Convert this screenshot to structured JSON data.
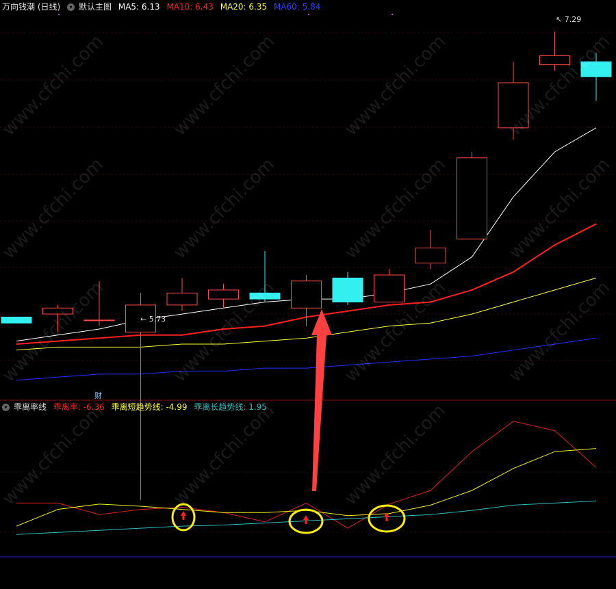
{
  "top_header": {
    "stock_name": "万向钱潮 (日线)",
    "main_chart_label": "默认主图",
    "ma5": "MA5: 6.13",
    "ma10": "MA10: 6.43",
    "ma20": "MA20: 6.35",
    "ma60": "MA60: 5.84",
    "colors": {
      "ma5": "#ffffff",
      "ma10": "#ff2020",
      "ma20": "#ffff33",
      "ma60": "#2030ff"
    }
  },
  "price_annotations": {
    "high": "7.29",
    "low": "5.73",
    "finance_mark": "财"
  },
  "bottom_header": {
    "indicator": "乖离率线",
    "bias": "乖离率: -6.36",
    "short_trend": "乖离短趋势线: -4.99",
    "long_trend": "乖离长趋势线: 1.95"
  },
  "watermark": "www.cfchi.com",
  "chart_data": [
    {
      "type": "candlestick",
      "title": "万向钱潮 (日线)",
      "candles": [
        {
          "open": 6.34,
          "close": 6.32,
          "high": 6.34,
          "low": 6.32
        },
        {
          "open": 6.35,
          "close": 6.37,
          "high": 6.38,
          "low": 6.29
        },
        {
          "open": 6.33,
          "close": 6.33,
          "high": 6.46,
          "low": 6.31
        },
        {
          "open": 6.29,
          "close": 6.38,
          "high": 6.42,
          "low": 5.73
        },
        {
          "open": 6.38,
          "close": 6.42,
          "high": 6.47,
          "low": 6.36
        },
        {
          "open": 6.4,
          "close": 6.43,
          "high": 6.45,
          "low": 6.37
        },
        {
          "open": 6.42,
          "close": 6.4,
          "high": 6.56,
          "low": 6.39
        },
        {
          "open": 6.37,
          "close": 6.46,
          "high": 6.48,
          "low": 6.31
        },
        {
          "open": 6.47,
          "close": 6.39,
          "high": 6.49,
          "low": 6.38
        },
        {
          "open": 6.39,
          "close": 6.48,
          "high": 6.5,
          "low": 6.39
        },
        {
          "open": 6.52,
          "close": 6.57,
          "high": 6.63,
          "low": 6.5
        },
        {
          "open": 6.6,
          "close": 6.87,
          "high": 6.89,
          "low": 6.6
        },
        {
          "open": 6.97,
          "close": 7.12,
          "high": 7.19,
          "low": 6.93
        },
        {
          "open": 7.18,
          "close": 7.21,
          "high": 7.29,
          "low": 7.16
        },
        {
          "open": 7.19,
          "close": 7.14,
          "high": 7.22,
          "low": 7.06
        }
      ],
      "series": [
        {
          "name": "MA5",
          "color": "#ffffff",
          "width": 1,
          "values": [
            6.26,
            6.28,
            6.3,
            6.33,
            6.35,
            6.37,
            6.39,
            6.4,
            6.4,
            6.42,
            6.45,
            6.54,
            6.74,
            6.89,
            6.97
          ]
        },
        {
          "name": "MA10",
          "color": "#ff2020",
          "width": 2,
          "values": [
            6.25,
            6.26,
            6.27,
            6.28,
            6.28,
            6.3,
            6.31,
            6.34,
            6.36,
            6.38,
            6.39,
            6.43,
            6.49,
            6.58,
            6.65
          ]
        },
        {
          "name": "MA20",
          "color": "#ffff33",
          "width": 1,
          "values": [
            6.23,
            6.24,
            6.24,
            6.24,
            6.25,
            6.25,
            6.26,
            6.27,
            6.29,
            6.31,
            6.32,
            6.35,
            6.39,
            6.43,
            6.47
          ]
        },
        {
          "name": "MA60",
          "color": "#2030ff",
          "width": 1,
          "values": [
            6.13,
            6.14,
            6.15,
            6.15,
            6.16,
            6.16,
            6.17,
            6.17,
            6.18,
            6.19,
            6.2,
            6.21,
            6.23,
            6.25,
            6.27
          ]
        }
      ],
      "ylim": [
        6.07,
        7.35
      ]
    },
    {
      "type": "line",
      "title": "乖离率线",
      "series": [
        {
          "name": "乖离率",
          "color": "#e02020",
          "values": [
            0.6,
            0.6,
            -0.5,
            0.0,
            0.2,
            -0.3,
            -1.2,
            0.6,
            -1.8,
            0.5,
            1.8,
            5.5,
            8.4,
            7.5,
            4.0
          ]
        },
        {
          "name": "乖离短趋势线",
          "color": "#f0f020",
          "values": [
            -1.6,
            0.0,
            0.5,
            0.3,
            0.0,
            -0.3,
            -0.3,
            -0.1,
            -0.6,
            -0.4,
            0.4,
            1.8,
            3.9,
            5.5,
            5.8
          ]
        },
        {
          "name": "乖离长趋势线",
          "color": "#30c0c0",
          "values": [
            -2.4,
            -2.2,
            -2.0,
            -1.8,
            -1.6,
            -1.5,
            -1.3,
            -1.1,
            -0.9,
            -0.7,
            -0.5,
            -0.1,
            0.4,
            0.6,
            0.8
          ]
        }
      ],
      "ylim": [
        -4.4,
        9.3
      ]
    }
  ]
}
